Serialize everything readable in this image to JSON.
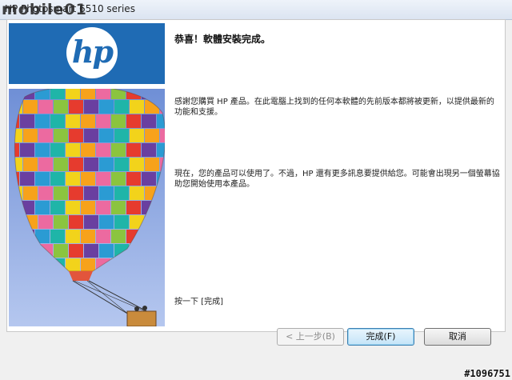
{
  "window": {
    "title": "HP Photosmart 6510 series",
    "watermark": "mobile01"
  },
  "wizard": {
    "heading": "恭喜！軟體安裝完成。",
    "paragraph1": "感謝您購買 HP 產品。在此電腦上找到的任何本軟體的先前版本都將被更新，以提供最新的功能和支援。",
    "paragraph2": "現在，您的產品可以使用了。不過，HP 還有更多訊息要提供給您。可能會出現另一個螢幕協助您開始使用本產品。",
    "paragraph3": "按一下 [完成]"
  },
  "logo": {
    "text": "hp",
    "color": "#1f6bb4"
  },
  "buttons": {
    "back": "< 上一步(B)",
    "finish": "完成(F)",
    "cancel": "取消"
  },
  "badge": "#1096751",
  "balloon_colors": [
    "#e63b2e",
    "#f7a21b",
    "#2b9bd3",
    "#8bc43f",
    "#f2d31b",
    "#6a3fa0",
    "#ec6aa0",
    "#1fb5a8"
  ]
}
